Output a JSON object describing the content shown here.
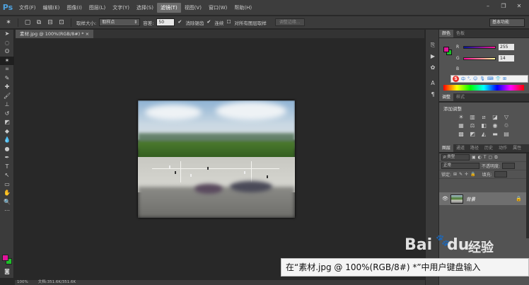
{
  "app": {
    "logo": "Ps"
  },
  "menu": [
    {
      "label": "文件(F)"
    },
    {
      "label": "编辑(E)"
    },
    {
      "label": "图像(I)"
    },
    {
      "label": "图层(L)"
    },
    {
      "label": "文字(Y)"
    },
    {
      "label": "选择(S)"
    },
    {
      "label": "滤镜(T)"
    },
    {
      "label": "视图(V)"
    },
    {
      "label": "窗口(W)"
    },
    {
      "label": "帮助(H)"
    }
  ],
  "options": {
    "sample_size_label": "取样大小:",
    "sample_size_value": "取样点",
    "tolerance_label": "容差:",
    "tolerance_value": "50",
    "antialias_label": "消除锯齿",
    "contiguous_label": "连续",
    "sample_all_label": "对所有图层取样",
    "refine_edge_label": "调整边缘...",
    "workspace_label": "基本功能"
  },
  "document": {
    "tab_title": "素材.jpg @ 100%(RGB/8#) * ×"
  },
  "status": {
    "zoom": "100%",
    "doc_size": "文档:351.6K/351.6K"
  },
  "color_panel": {
    "tabs": [
      {
        "label": "颜色"
      },
      {
        "label": "色板"
      }
    ],
    "r_label": "R",
    "r_value": "255",
    "g_label": "G",
    "g_value": "14",
    "b_label": "B",
    "fg_color": "#e0149a",
    "bg_color": "#1ec02a"
  },
  "ime": {
    "logo": "S",
    "items": [
      "中",
      "°,",
      "☺",
      "🎙",
      "⌨",
      "👕",
      "⊞"
    ]
  },
  "adjust_panel": {
    "tabs": [
      {
        "label": "调整"
      },
      {
        "label": "样式"
      }
    ],
    "title": "添加调整"
  },
  "layers_panel": {
    "tabs": [
      {
        "label": "图层"
      },
      {
        "label": "通道"
      },
      {
        "label": "路径"
      },
      {
        "label": "历史"
      },
      {
        "label": "动作"
      },
      {
        "label": "属性"
      }
    ],
    "filter_label": "ρ 类型",
    "blend_mode": "正常",
    "opacity_label": "不透明度:",
    "lock_label": "锁定:",
    "fill_label": "填充:",
    "layer_name": "背景"
  },
  "tooltip": {
    "text": "在“素材.jpg @ 100%(RGB/8#) *”中用户键盘输入"
  },
  "watermark": {
    "text1": "Bai",
    "text2": "du",
    "text3": "经验"
  }
}
